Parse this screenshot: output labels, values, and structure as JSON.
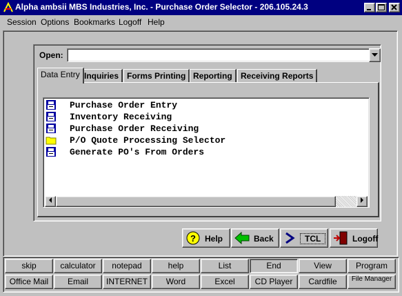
{
  "window": {
    "title": "Alpha ambsii MBS Industries, Inc. - Purchase Order Selector - 206.105.24.3"
  },
  "menu": [
    "Session",
    "Options",
    "Bookmarks",
    "Logoff",
    "Help"
  ],
  "open": {
    "label": "Open:",
    "value": ""
  },
  "tabs": [
    "Data Entry",
    "Inquiries",
    "Forms Printing",
    "Reporting",
    "Receiving Reports"
  ],
  "list": [
    {
      "label": "Purchase Order Entry",
      "icon": "program-icon"
    },
    {
      "label": "Inventory Receiving",
      "icon": "program-icon"
    },
    {
      "label": "Purchase Order Receiving",
      "icon": "program-icon"
    },
    {
      "label": "P/O Quote Processing Selector",
      "icon": "folder-icon"
    },
    {
      "label": "Generate PO's From Orders",
      "icon": "program-icon"
    }
  ],
  "actions": {
    "help": "Help",
    "back": "Back",
    "tcl": "TCL",
    "logoff": "Logoff"
  },
  "launcher": {
    "row1": [
      "skip",
      "calculator",
      "notepad",
      "help",
      "List",
      "End",
      "View",
      "Program"
    ],
    "row2": [
      "Office Mail",
      "Email",
      "INTERNET",
      "Word",
      "Excel",
      "CD Player",
      "Cardfile",
      "File Manager"
    ]
  },
  "colors": {
    "titlebar": "#000080",
    "face": "#c0c0c0"
  }
}
